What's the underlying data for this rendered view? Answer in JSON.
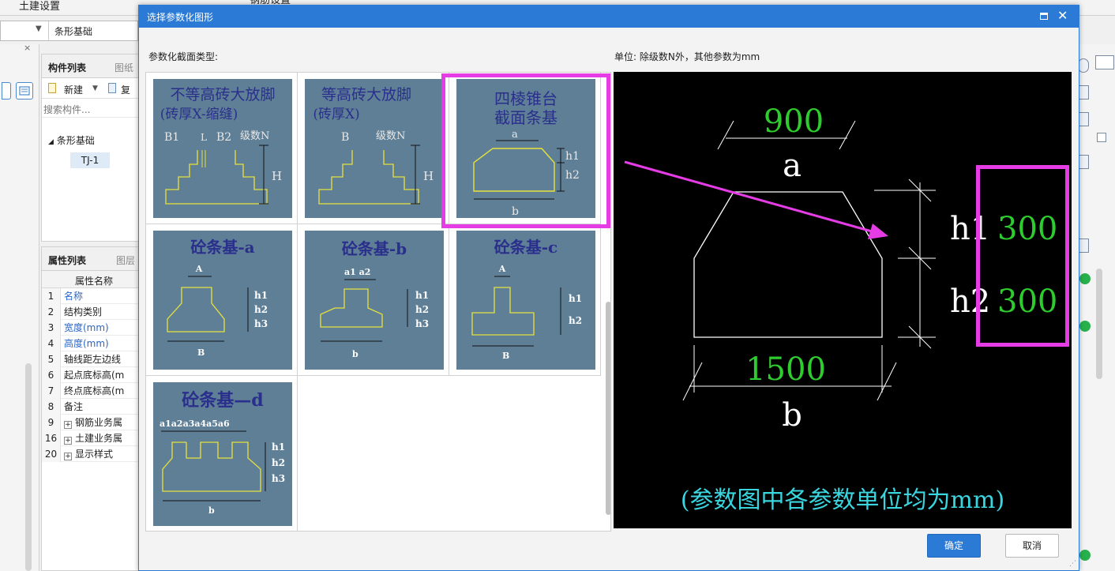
{
  "app": {
    "top_tabs": [
      "土建设置",
      "钢筋设置"
    ],
    "component_combo": "条形基础",
    "complist": {
      "tab_active": "构件列表",
      "tab_other": "图纸",
      "new_label": "新建",
      "copy_label": "复",
      "search_placeholder": "搜索构件...",
      "tree_parent": "条形基础",
      "tree_child": "TJ-1"
    },
    "proplist": {
      "tab_active": "属性列表",
      "tab_other": "图层",
      "col_header": "属性名称",
      "rows": [
        {
          "num": "1",
          "name": "名称"
        },
        {
          "num": "2",
          "name": "结构类别"
        },
        {
          "num": "3",
          "name": "宽度(mm)"
        },
        {
          "num": "4",
          "name": "高度(mm)"
        },
        {
          "num": "5",
          "name": "轴线距左边线"
        },
        {
          "num": "6",
          "name": "起点底标高(m"
        },
        {
          "num": "7",
          "name": "终点底标高(m"
        },
        {
          "num": "8",
          "name": "备注"
        },
        {
          "num": "9",
          "name": "钢筋业务属"
        },
        {
          "num": "16",
          "name": "土建业务属"
        },
        {
          "num": "20",
          "name": "显示样式"
        }
      ]
    }
  },
  "dialog": {
    "title": "选择参数化图形",
    "type_label": "参数化截面类型:",
    "unit_label": "单位:  除级数N外，其他参数为mm",
    "ok_label": "确定",
    "cancel_label": "取消",
    "selected_index": 2,
    "shapes": [
      {
        "title1": "不等高砖大放脚",
        "title2": "(砖厚X-缩缝)",
        "labels": [
          "B1",
          "L",
          "B2",
          "级数N",
          "H"
        ]
      },
      {
        "title1": "等高砖大放脚",
        "title2": "(砖厚X)",
        "labels": [
          "B",
          "级数N",
          "H"
        ]
      },
      {
        "title1": "四棱锥台",
        "title2": "截面条基",
        "labels": [
          "a",
          "h1",
          "h2",
          "b"
        ]
      },
      {
        "title1": "砼条基-a",
        "labels": [
          "A",
          "h1",
          "h2",
          "h3",
          "B"
        ]
      },
      {
        "title1": "砼条基-b",
        "labels": [
          "a1 a2",
          "h1",
          "h2",
          "h3",
          "b"
        ]
      },
      {
        "title1": "砼条基-c",
        "labels": [
          "A",
          "h1",
          "h2",
          "B"
        ]
      },
      {
        "title1": "砼条基—d",
        "labels": [
          "a1a2a3a4a5a6",
          "h1",
          "h2",
          "h3",
          "b"
        ]
      }
    ],
    "preview": {
      "a_value": "900",
      "a_label": "a",
      "h1_label": "h1",
      "h1_value": "300",
      "h2_label": "h2",
      "h2_value": "300",
      "b_value": "1500",
      "b_label": "b",
      "note": "(参数图中各参数单位均为mm)"
    }
  },
  "colors": {
    "dialog_blue": "#2b7ad6",
    "highlight_magenta": "#e63ce6",
    "thumb_bg": "#5e7f96",
    "thumb_text": "#2a2f8c",
    "thumb_line": "#e8e23c",
    "value_green": "#2ecc2e",
    "note_cyan": "#3ad6e0"
  }
}
